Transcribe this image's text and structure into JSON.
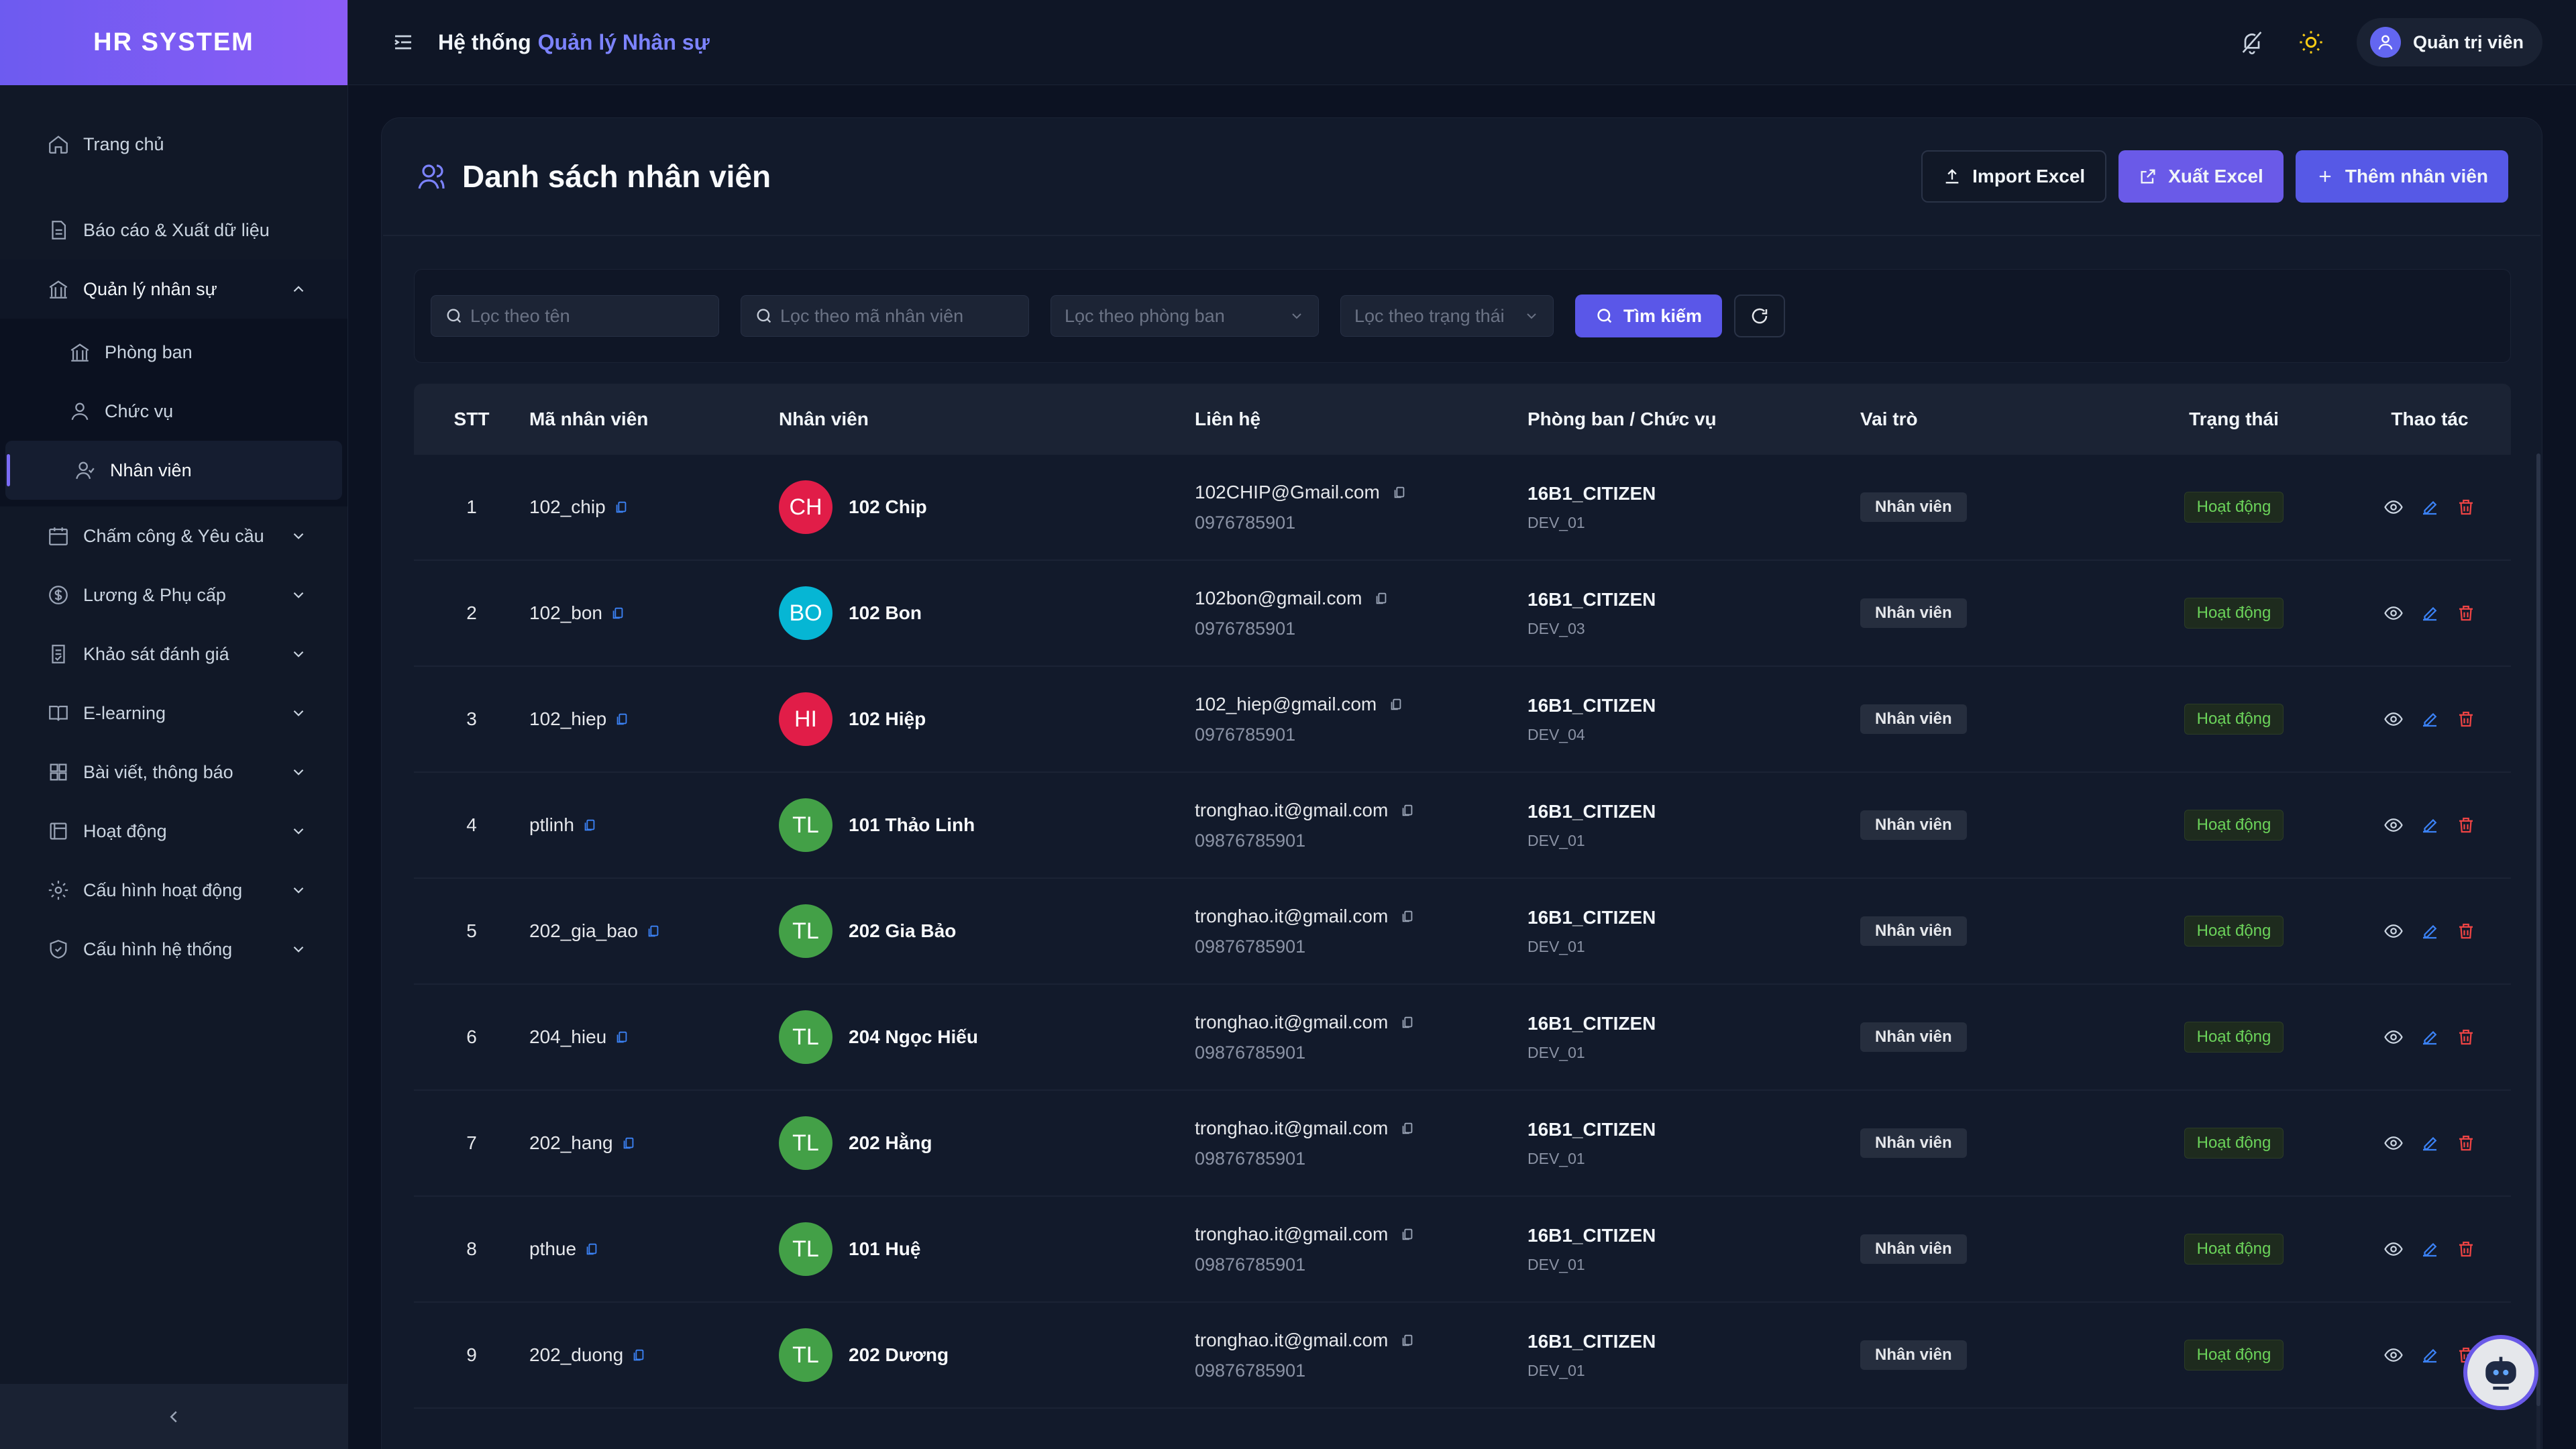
{
  "brand": "HR SYSTEM",
  "sidebar": {
    "items": [
      {
        "label": "Trang chủ",
        "icon": "home-icon"
      },
      {
        "label": "Báo cáo & Xuất dữ liệu",
        "icon": "report-icon"
      },
      {
        "label": "Quản lý nhân sự",
        "icon": "building-icon",
        "expanded": true
      },
      {
        "label": "Chấm công & Yêu cầu",
        "icon": "calendar-icon"
      },
      {
        "label": "Lương & Phụ cấp",
        "icon": "dollar-icon"
      },
      {
        "label": "Khảo sát đánh giá",
        "icon": "survey-icon"
      },
      {
        "label": "E-learning",
        "icon": "book-icon"
      },
      {
        "label": "Bài viết, thông báo",
        "icon": "grid-icon"
      },
      {
        "label": "Hoạt động",
        "icon": "activity-icon"
      },
      {
        "label": "Cấu hình hoạt động",
        "icon": "gear-icon"
      },
      {
        "label": "Cấu hình hệ thống",
        "icon": "shield-icon"
      }
    ],
    "subitems": [
      {
        "label": "Phòng ban",
        "icon": "building-icon"
      },
      {
        "label": "Chức vụ",
        "icon": "user-icon"
      },
      {
        "label": "Nhân viên",
        "icon": "users-icon",
        "active": true
      }
    ]
  },
  "topbar": {
    "title_prefix": "Hệ thống",
    "title_accent": "Quản lý Nhân sự",
    "user": "Quản trị viên"
  },
  "page": {
    "title": "Danh sách nhân viên",
    "buttons": {
      "import": "Import Excel",
      "export": "Xuất Excel",
      "add": "Thêm nhân viên"
    }
  },
  "filters": {
    "name_placeholder": "Lọc theo tên",
    "code_placeholder": "Lọc theo mã nhân viên",
    "dept_placeholder": "Lọc theo phòng ban",
    "status_placeholder": "Lọc theo trạng thái",
    "search_label": "Tìm kiếm"
  },
  "table": {
    "headers": {
      "stt": "STT",
      "code": "Mã nhân viên",
      "employee": "Nhân viên",
      "contact": "Liên hệ",
      "dept": "Phòng ban / Chức vụ",
      "role": "Vai trò",
      "status": "Trạng thái",
      "actions": "Thao tác"
    },
    "rows": [
      {
        "stt": "1",
        "code": "102_chip",
        "initials": "CH",
        "avatar_color": "#e11d48",
        "name": "102 Chip",
        "email": "102CHIP@Gmail.com",
        "phone": "0976785901",
        "dept": "16B1_CITIZEN",
        "pos": "DEV_01",
        "role": "Nhân viên",
        "status": "Hoạt động"
      },
      {
        "stt": "2",
        "code": "102_bon",
        "initials": "BO",
        "avatar_color": "#06b6d4",
        "name": "102 Bon",
        "email": "102bon@gmail.com",
        "phone": "0976785901",
        "dept": "16B1_CITIZEN",
        "pos": "DEV_03",
        "role": "Nhân viên",
        "status": "Hoạt động"
      },
      {
        "stt": "3",
        "code": "102_hiep",
        "initials": "HI",
        "avatar_color": "#e11d48",
        "name": "102 Hiệp",
        "email": "102_hiep@gmail.com",
        "phone": "0976785901",
        "dept": "16B1_CITIZEN",
        "pos": "DEV_04",
        "role": "Nhân viên",
        "status": "Hoạt động"
      },
      {
        "stt": "4",
        "code": "ptlinh",
        "initials": "TL",
        "avatar_color": "#43a047",
        "name": "101 Thảo Linh",
        "email": "tronghao.it@gmail.com",
        "phone": "09876785901",
        "dept": "16B1_CITIZEN",
        "pos": "DEV_01",
        "role": "Nhân viên",
        "status": "Hoạt động"
      },
      {
        "stt": "5",
        "code": "202_gia_bao",
        "initials": "TL",
        "avatar_color": "#43a047",
        "name": "202 Gia Bảo",
        "email": "tronghao.it@gmail.com",
        "phone": "09876785901",
        "dept": "16B1_CITIZEN",
        "pos": "DEV_01",
        "role": "Nhân viên",
        "status": "Hoạt động"
      },
      {
        "stt": "6",
        "code": "204_hieu",
        "initials": "TL",
        "avatar_color": "#43a047",
        "name": "204 Ngọc Hiếu",
        "email": "tronghao.it@gmail.com",
        "phone": "09876785901",
        "dept": "16B1_CITIZEN",
        "pos": "DEV_01",
        "role": "Nhân viên",
        "status": "Hoạt động"
      },
      {
        "stt": "7",
        "code": "202_hang",
        "initials": "TL",
        "avatar_color": "#43a047",
        "name": "202 Hằng",
        "email": "tronghao.it@gmail.com",
        "phone": "09876785901",
        "dept": "16B1_CITIZEN",
        "pos": "DEV_01",
        "role": "Nhân viên",
        "status": "Hoạt động"
      },
      {
        "stt": "8",
        "code": "pthue",
        "initials": "TL",
        "avatar_color": "#43a047",
        "name": "101 Huệ",
        "email": "tronghao.it@gmail.com",
        "phone": "09876785901",
        "dept": "16B1_CITIZEN",
        "pos": "DEV_01",
        "role": "Nhân viên",
        "status": "Hoạt động"
      },
      {
        "stt": "9",
        "code": "202_duong",
        "initials": "TL",
        "avatar_color": "#43a047",
        "name": "202 Dương",
        "email": "tronghao.it@gmail.com",
        "phone": "09876785901",
        "dept": "16B1_CITIZEN",
        "pos": "DEV_01",
        "role": "Nhân viên",
        "status": "Hoạt động"
      }
    ]
  },
  "colors": {
    "accent": "#6a5ae8",
    "status_active": "#6bd35a",
    "danger": "#ef4444",
    "link": "#3b82f6"
  }
}
